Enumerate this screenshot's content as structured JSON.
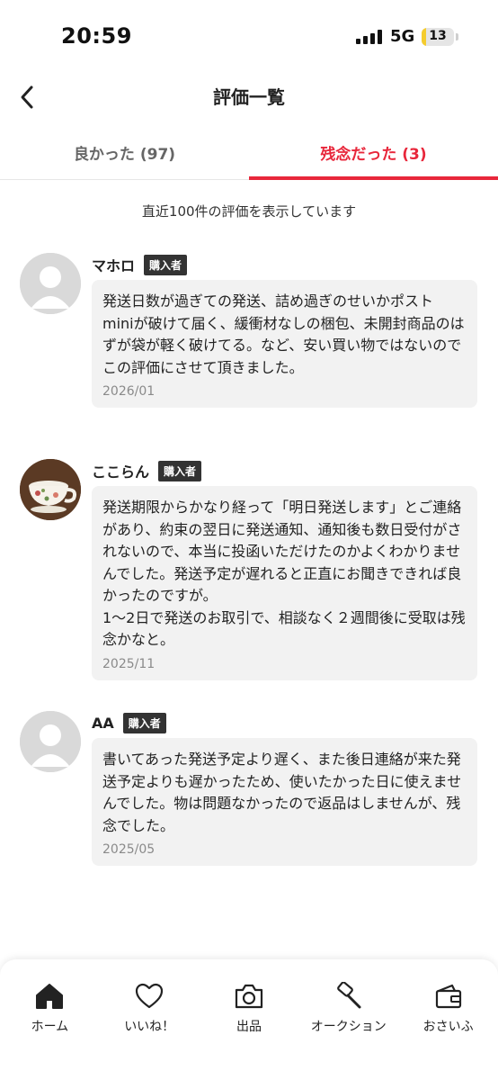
{
  "status_bar": {
    "time": "20:59",
    "network": "5G",
    "battery_level": "13"
  },
  "header": {
    "title": "評価一覧"
  },
  "tabs": [
    {
      "label": "良かった (97)",
      "active": false
    },
    {
      "label": "残念だった (3)",
      "active": true
    }
  ],
  "notice": "直近100件の評価を表示しています",
  "reviews": [
    {
      "name": "マホロ",
      "badge": "購入者",
      "text": "発送日数が過ぎての発送、詰め過ぎのせいかポスト miniが破けて届く、緩衝材なしの梱包、未開封商品のはずが袋が軽く破けてる。など、安い買い物ではないのでこの評価にさせて頂きました。",
      "date": "2026/01"
    },
    {
      "name": "ここらん",
      "badge": "購入者",
      "text": "発送期限からかなり経って「明日発送します」とご連絡があり、約束の翌日に発送通知、通知後も数日受付がされないので、本当に投函いただけたのかよくわかりませんでした。発送予定が遅れると正直にお聞きできれば良かったのですが。\n1～2日で発送のお取引で、相談なく２週間後に受取は残念かなと。",
      "date": "2025/11"
    },
    {
      "name": "AA",
      "badge": "購入者",
      "text": "書いてあった発送予定より遅く、また後日連絡が来た発送予定よりも遅かったため、使いたかった日に使えませんでした。物は問題なかったので返品はしませんが、残念でした。",
      "date": "2025/05"
    }
  ],
  "bottom_nav": [
    {
      "label": "ホーム",
      "icon": "home-icon"
    },
    {
      "label": "いいね！",
      "icon": "heart-icon"
    },
    {
      "label": "出品",
      "icon": "camera-icon"
    },
    {
      "label": "オークション",
      "icon": "gavel-icon"
    },
    {
      "label": "おさいふ",
      "icon": "wallet-icon"
    }
  ],
  "colors": {
    "accent": "#e8273b",
    "bubble": "#f2f2f2",
    "badge": "#333333"
  }
}
